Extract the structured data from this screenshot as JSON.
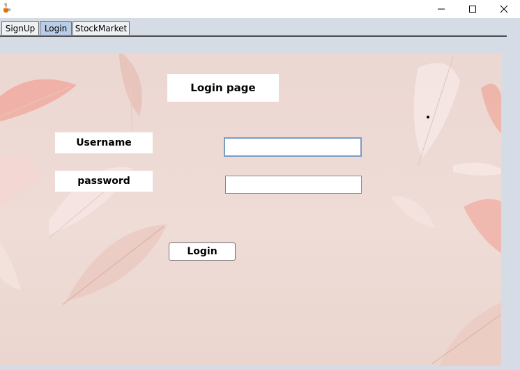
{
  "window": {
    "icon": "java-cup-icon",
    "controls": [
      "minimize-icon",
      "maximize-icon",
      "close-icon"
    ]
  },
  "tabs": [
    {
      "label": "SignUp",
      "active": false
    },
    {
      "label": "Login",
      "active": true
    },
    {
      "label": "StockMarket",
      "active": false
    }
  ],
  "login": {
    "title": "Login page",
    "username_label": "Username",
    "password_label": "password",
    "username_value": "",
    "password_value": "",
    "submit_label": "Login"
  },
  "colors": {
    "window_bg": "#d6dce6",
    "panel_bg": "#ecd7d2",
    "active_tab": "#b9cde6",
    "focus_border": "#7a9bc4"
  }
}
